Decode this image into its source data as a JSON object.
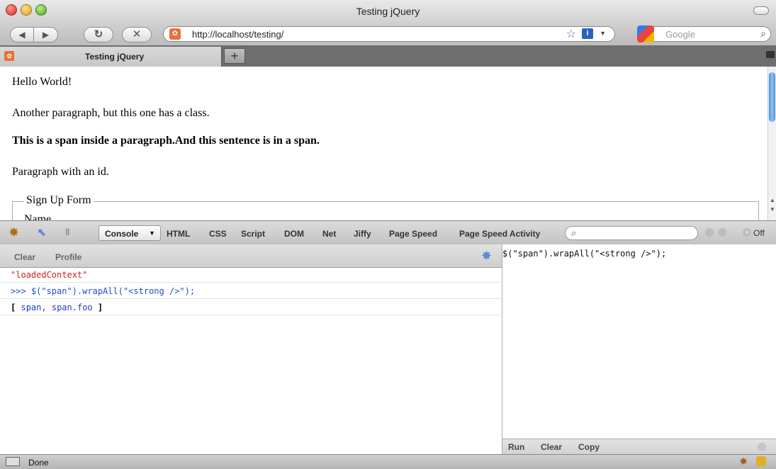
{
  "window": {
    "title": "Testing jQuery"
  },
  "navbar": {
    "url": "http://localhost/testing/",
    "search_placeholder": "Google"
  },
  "tab": {
    "label": "Testing jQuery",
    "new_tab_label": "+"
  },
  "page": {
    "lines": [
      "Hello World!",
      "Another paragraph, but this one has a class.",
      "This is a span inside a paragraph.And this sentence is in a span.",
      "Paragraph with an id."
    ],
    "fieldset_legend": "Sign Up Form",
    "partial_label": "Name"
  },
  "firebug": {
    "tabs": [
      "Console",
      "HTML",
      "CSS",
      "Script",
      "DOM",
      "Net",
      "Jiffy",
      "Page Speed",
      "Page Speed Activity"
    ],
    "off_label": "Off",
    "left_toolbar": {
      "clear": "Clear",
      "profile": "Profile"
    },
    "console": {
      "line1": "\"loadedContext\"",
      "line2": ">>> $(\"span\").wrapAll(\"<strong />\");",
      "result_open": "[",
      "result_item1": "span",
      "result_sep": ",",
      "result_item2": "span.foo",
      "result_close": "]"
    },
    "right_pane": {
      "code": "$(\"span\").wrapAll(\"<strong />\");",
      "run": "Run",
      "clear": "Clear",
      "copy": "Copy"
    }
  },
  "status": {
    "text": "Done"
  },
  "colors": {
    "console_string": "#d32020",
    "console_command": "#1f4fd6",
    "console_link": "#1a3ecf"
  }
}
